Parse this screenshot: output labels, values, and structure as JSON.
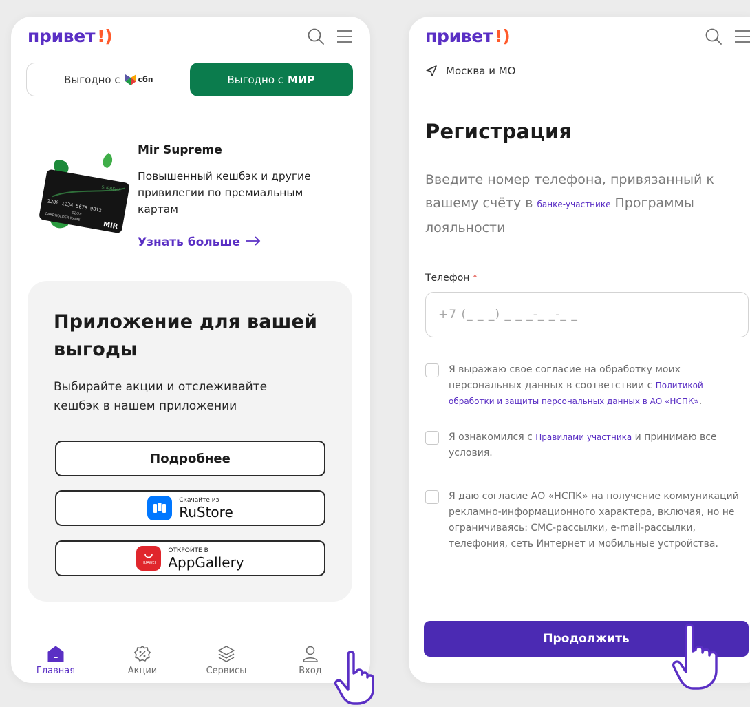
{
  "brand": {
    "word": "привет",
    "mark": "!)",
    "color_primary": "#5a2fc4",
    "color_green": "#0b7c4d",
    "color_button": "#4b2ab3"
  },
  "left": {
    "header": {
      "icons": [
        "search-icon",
        "menu-icon"
      ]
    },
    "tabs": [
      {
        "label": "Выгодно с",
        "brand": "сбп",
        "active": false
      },
      {
        "label": "Выгодно с",
        "brand": "МИР",
        "active": true
      }
    ],
    "promo": {
      "title": "Mir Supreme",
      "text": "Повышенный кешбэк и другие привилегии по премиальным картам",
      "link": "Узнать больше",
      "card": {
        "number": "2200 1234 5678 9012",
        "expiry": "02/28",
        "name": "CARDHOLDER NAME",
        "brand": "MIR",
        "series": "SUPREME"
      }
    },
    "app_block": {
      "title": "Приложение для вашей выгоды",
      "subtitle": "Выбирайте акции и отслеживайте кешбэк в нашем приложении",
      "more_button": "Подробнее",
      "rustore": {
        "small": "Скачайте из",
        "big": "RuStore",
        "icon_label": "ru"
      },
      "appgallery": {
        "small": "ОТКРОЙТЕ В",
        "big": "AppGallery",
        "icon_label": "HUAWEI"
      }
    },
    "nav": [
      {
        "label": "Главная",
        "icon": "home-icon",
        "active": true
      },
      {
        "label": "Акции",
        "icon": "discount-icon",
        "active": false
      },
      {
        "label": "Сервисы",
        "icon": "layers-icon",
        "active": false
      },
      {
        "label": "Вход",
        "icon": "user-icon",
        "active": false
      }
    ]
  },
  "right": {
    "header": {
      "icons": [
        "search-icon",
        "menu-icon"
      ]
    },
    "location": "Москва и МО",
    "title": "Регистрация",
    "description": {
      "before": "Введите номер телефона, привязанный к вашему счёту в ",
      "link": "банке-участнике",
      "after": " Программы лояльности"
    },
    "phone_field": {
      "label": "Телефон",
      "required_mark": "*",
      "placeholder": "+7 (_ _ _) _ _ _-_ _-_ _"
    },
    "consents": [
      {
        "before": "Я выражаю свое согласие на обработку моих персональных данных в соответствии с ",
        "link": "Политикой обработки и защиты персональных данных в АО «НСПК»",
        "after": "."
      },
      {
        "before": "Я ознакомился с ",
        "link": "Правилами участника",
        "after": " и принимаю все условия."
      },
      {
        "before": "Я даю согласие АО «НСПК» на получение коммуникаций рекламно-информационного характера, включая, но не ограничиваясь: СМС-рассылки, e-mail-рассылки, телефония, сеть Интернет и мобильные устройства.",
        "link": "",
        "after": ""
      }
    ],
    "continue_button": "Продолжить"
  }
}
